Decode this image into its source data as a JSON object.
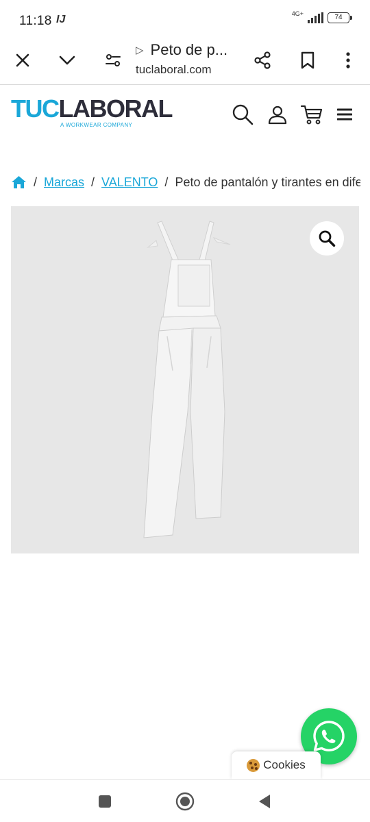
{
  "status": {
    "time": "11:18",
    "extra_icon": "IJ",
    "network": "4G+",
    "battery": "74"
  },
  "browser": {
    "page_title": "Peto de p...",
    "play_glyph": "▷",
    "domain": "tuclaboral.com",
    "icons": [
      "close-icon",
      "chevron-down-icon",
      "page-settings-icon",
      "share-icon",
      "bookmark-icon",
      "more-vert-icon"
    ]
  },
  "site": {
    "logo_tuc": "TUC",
    "logo_laboral": "LABORAL",
    "logo_tagline": "A WORKWEAR COMPANY",
    "brand_color": "#1aa7d8",
    "icons": [
      "search-icon",
      "user-icon",
      "cart-icon",
      "menu-icon"
    ]
  },
  "breadcrumb": {
    "home_icon": "home-icon",
    "sep": "/",
    "items": [
      "Marcas",
      "VALENTO"
    ],
    "current": "Peto de pantalón y tirantes en diferentes colores"
  },
  "product": {
    "image_icon": "bib-overall-image",
    "zoom_icon": "zoom-icon"
  },
  "floating": {
    "whatsapp_icon": "whatsapp-icon",
    "cookies_label": "Cookies",
    "whatsapp_color": "#25d366"
  },
  "navbar": {
    "icons": [
      "recents-icon",
      "home-nav-icon",
      "back-icon"
    ]
  }
}
